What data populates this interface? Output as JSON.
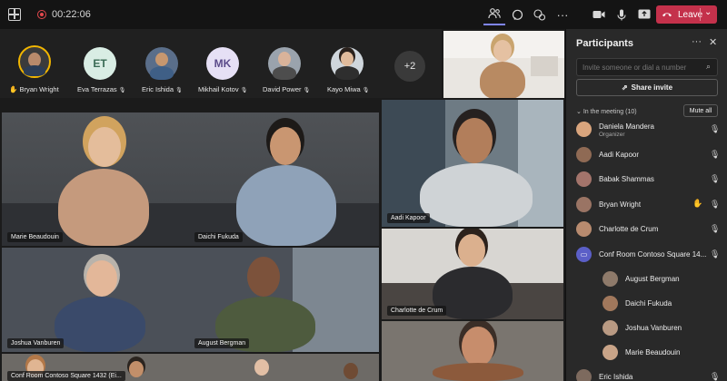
{
  "topbar": {
    "timer": "00:22:06",
    "leave_label": "Leave"
  },
  "icons": {
    "layout": "grid-icon",
    "record": "record-icon",
    "people": "people-icon",
    "chat": "chat-icon",
    "reactions": "reactions-icon",
    "more": "more-icon",
    "camera": "camera-icon",
    "mic": "mic-icon",
    "share": "share-screen-icon",
    "hangup": "hangup-icon"
  },
  "avatars": [
    {
      "name": "Bryan Wright",
      "initials": "",
      "hand": "✋"
    },
    {
      "name": "Eva Terrazas",
      "initials": "ET",
      "muted": "🎙"
    },
    {
      "name": "Eric Ishida",
      "initials": "",
      "muted": "🎙"
    },
    {
      "name": "Mikhail Kotov",
      "initials": "MK",
      "muted": "🎙"
    },
    {
      "name": "David Power",
      "initials": "",
      "muted": "🎙"
    },
    {
      "name": "Kayo Miwa",
      "initials": "",
      "muted": "🎙"
    }
  ],
  "overflow_count": "+2",
  "tiles": {
    "t1": "Marie Beaudouin",
    "t2": "Daichi Fukuda",
    "t3": "Aadi Kapoor",
    "t4": "Joshua Vanburen",
    "t5": "August Bergman",
    "t6": "Charlotte de Crum",
    "t7": "Conf Room Contoso Square 1432 (Ei..."
  },
  "panel": {
    "title": "Participants",
    "invite_placeholder": "Invite someone or dial a number",
    "share_invite": "Share invite",
    "section": "In the meeting (10)",
    "mute_all": "Mute all",
    "participants": [
      {
        "name": "Daniela Mandera",
        "role": "Organizer"
      },
      {
        "name": "Aadi Kapoor",
        "role": ""
      },
      {
        "name": "Babak Shammas",
        "role": ""
      },
      {
        "name": "Bryan Wright",
        "role": ""
      },
      {
        "name": "Charlotte de Crum",
        "role": ""
      },
      {
        "name": "Conf Room Contoso Square 14...",
        "role": ""
      },
      {
        "name": "August Bergman",
        "role": ""
      },
      {
        "name": "Daichi Fukuda",
        "role": ""
      },
      {
        "name": "Joshua Vanburen",
        "role": ""
      },
      {
        "name": "Marie Beaudouin",
        "role": ""
      },
      {
        "name": "Eric Ishida",
        "role": ""
      }
    ]
  },
  "colors": {
    "accent": "#7f85f5",
    "leave": "#c4314b",
    "hand": "#f2b600"
  }
}
